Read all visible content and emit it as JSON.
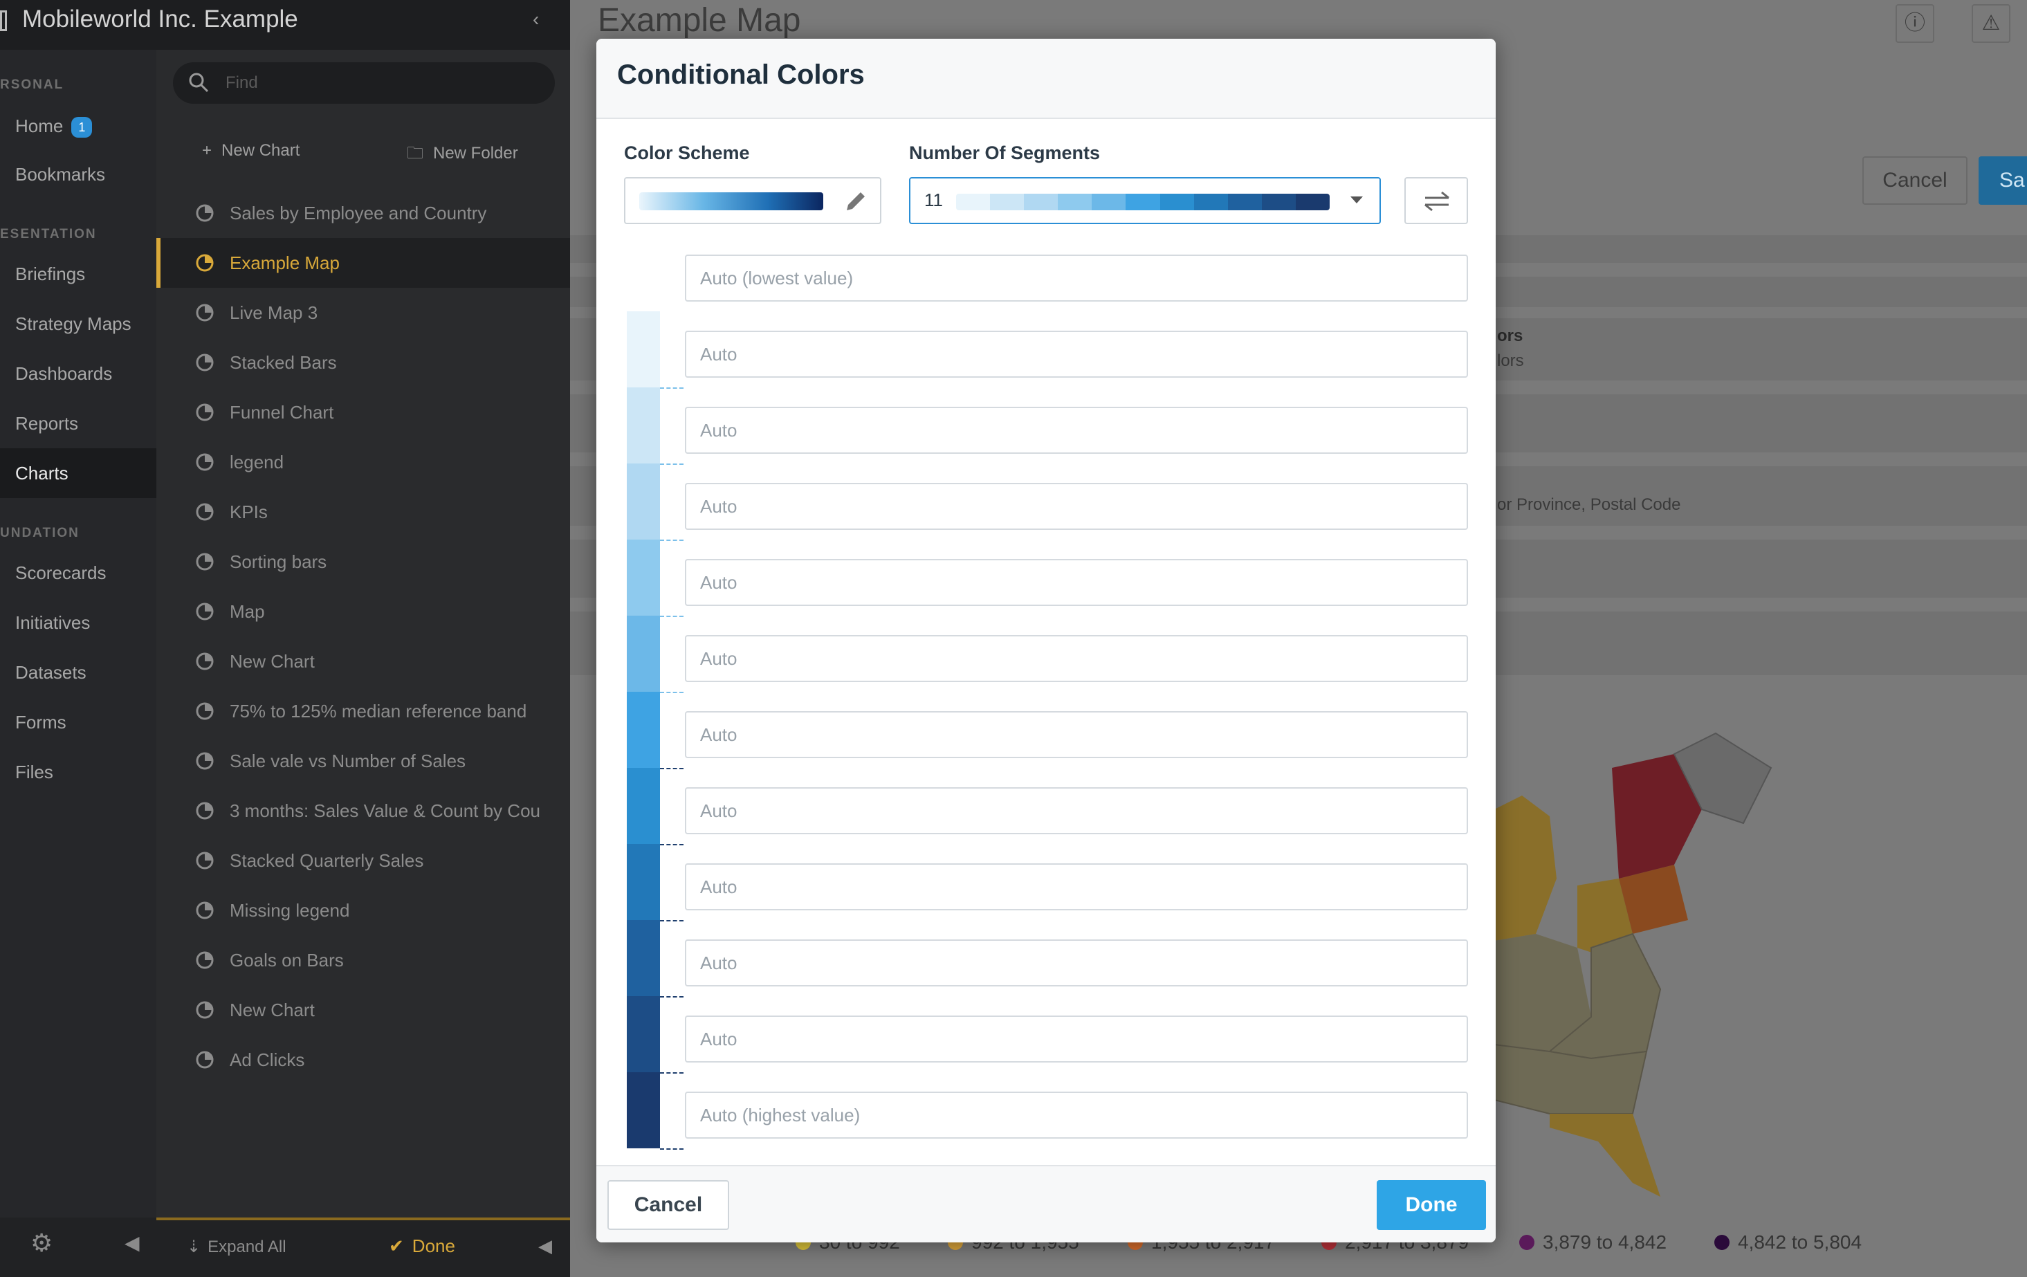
{
  "app": {
    "title": "Mobileworld Inc. Example"
  },
  "nav": {
    "sections": [
      "RSONAL",
      "ESENTATION",
      "UNDATION"
    ],
    "items": [
      {
        "label": "Home",
        "badge": "1"
      },
      {
        "label": "Bookmarks"
      },
      {
        "label": "Briefings"
      },
      {
        "label": "Strategy Maps"
      },
      {
        "label": "Dashboards"
      },
      {
        "label": "Reports"
      },
      {
        "label": "Charts"
      },
      {
        "label": "Scorecards"
      },
      {
        "label": "Initiatives"
      },
      {
        "label": "Datasets"
      },
      {
        "label": "Forms"
      },
      {
        "label": "Files"
      }
    ]
  },
  "panel": {
    "find_placeholder": "Find",
    "new_chart": "New Chart",
    "new_folder": "New Folder",
    "charts": [
      "Sales by Employee and Country",
      "Example Map",
      "Live Map 3",
      "Stacked Bars",
      "Funnel Chart",
      "legend",
      "KPIs",
      "Sorting bars",
      "Map",
      "New Chart",
      "75% to 125% median reference band",
      "Sale vale vs Number of Sales",
      "3 months: Sales Value & Count by Cou",
      "Stacked Quarterly Sales",
      "Missing legend",
      "Goals on Bars",
      "New Chart",
      "Ad Clicks"
    ],
    "expand_all": "Expand All",
    "done": "Done"
  },
  "page": {
    "title": "Example Map",
    "cancel": "Cancel",
    "save": "Sa",
    "row1_a": "ors",
    "row1_b": "lors",
    "row2": "or Province, Postal Code",
    "legend": [
      "30 to 992",
      "992 to 1,955",
      "1,955 to 2,917",
      "2,917 to 3,879",
      "3,879 to 4,842",
      "4,842 to 5,804"
    ],
    "legend_colors": [
      "#d9c23a",
      "#d8a23a",
      "#d46a2a",
      "#b8323a",
      "#5a1a5a",
      "#2a0a3a"
    ]
  },
  "modal": {
    "title": "Conditional Colors",
    "color_scheme_label": "Color Scheme",
    "segments_label": "Number Of Segments",
    "segments_value": "11",
    "inputs": [
      "Auto (lowest value)",
      "Auto",
      "Auto",
      "Auto",
      "Auto",
      "Auto",
      "Auto",
      "Auto",
      "Auto",
      "Auto",
      "Auto",
      "Auto (highest value)"
    ],
    "segment_colors": [
      "#e8f4fb",
      "#cce6f6",
      "#b0d8f2",
      "#8ecaee",
      "#6cb8e8",
      "#3ea3e3",
      "#2a8fd0",
      "#2278b8",
      "#1f619f",
      "#1d4d86",
      "#1a3a6e",
      "#182c58"
    ],
    "cancel": "Cancel",
    "done": "Done"
  }
}
